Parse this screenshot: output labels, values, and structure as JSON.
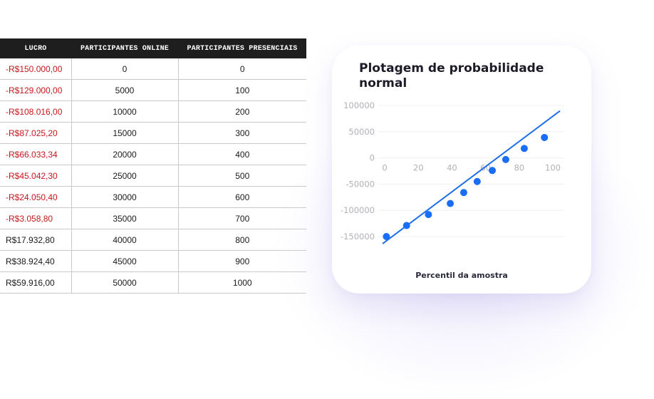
{
  "table": {
    "headers": [
      "LUCRO",
      "PARTICIPANTES ONLINE",
      "PARTICIPANTES PRESENCIAIS"
    ],
    "rows": [
      {
        "lucro": "-R$150.000,00",
        "online": "0",
        "presenciais": "0",
        "negative": true
      },
      {
        "lucro": "-R$129.000,00",
        "online": "5000",
        "presenciais": "100",
        "negative": true
      },
      {
        "lucro": "-R$108.016,00",
        "online": "10000",
        "presenciais": "200",
        "negative": true
      },
      {
        "lucro": "-R$87.025,20",
        "online": "15000",
        "presenciais": "300",
        "negative": true
      },
      {
        "lucro": "-R$66.033,34",
        "online": "20000",
        "presenciais": "400",
        "negative": true
      },
      {
        "lucro": "-R$45.042,30",
        "online": "25000",
        "presenciais": "500",
        "negative": true
      },
      {
        "lucro": "-R$24.050,40",
        "online": "30000",
        "presenciais": "600",
        "negative": true
      },
      {
        "lucro": "-R$3.058,80",
        "online": "35000",
        "presenciais": "700",
        "negative": true
      },
      {
        "lucro": "R$17.932,80",
        "online": "40000",
        "presenciais": "800",
        "negative": false
      },
      {
        "lucro": "R$38.924,40",
        "online": "45000",
        "presenciais": "900",
        "negative": false
      },
      {
        "lucro": "R$59.916,00",
        "online": "50000",
        "presenciais": "1000",
        "negative": false
      }
    ]
  },
  "colors": {
    "header_bg": "#1e1e1e",
    "negative_text": "#c8161d",
    "line": "#1f6fe8",
    "point": "#1a6ef5",
    "tick": "#b0b0b8"
  },
  "chart_data": {
    "type": "line",
    "title": "Plotagem de probabilidade normal",
    "xlabel": "Percentil da amostra",
    "ylabel": "",
    "xlim": [
      0,
      100
    ],
    "ylim": [
      -150000,
      100000
    ],
    "x_ticks": [
      "0",
      "20",
      "40",
      "60",
      "80",
      "100"
    ],
    "y_ticks": [
      "100000",
      "50000",
      "0",
      "-50000",
      "-100000",
      "-150000"
    ],
    "grid": true,
    "series": [
      {
        "points": [
          {
            "x": 1,
            "y": -150000
          },
          {
            "x": 13,
            "y": -129000
          },
          {
            "x": 26,
            "y": -108016
          },
          {
            "x": 39,
            "y": -87025
          },
          {
            "x": 47,
            "y": -66033
          },
          {
            "x": 55,
            "y": -45042
          },
          {
            "x": 64,
            "y": -24050
          },
          {
            "x": 72,
            "y": -3059
          },
          {
            "x": 83,
            "y": 17933
          },
          {
            "x": 95,
            "y": 38924
          }
        ],
        "line": [
          {
            "x": -1,
            "y": -163000
          },
          {
            "x": 104,
            "y": 89000
          }
        ]
      }
    ]
  }
}
